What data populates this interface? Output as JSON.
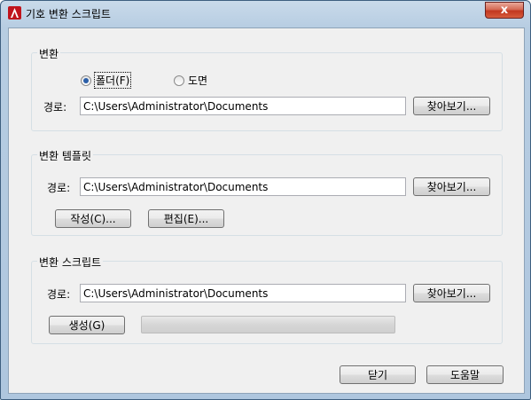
{
  "window": {
    "title": "기호 변환 스크립트",
    "close_label": "x"
  },
  "convert": {
    "label": "변환",
    "radio_folder": "폴더(F)",
    "radio_drawing": "도면",
    "path_label": "경로:",
    "path_value": "C:\\Users\\Administrator\\Documents",
    "browse_label": "찾아보기..."
  },
  "template": {
    "label": "변환 템플릿",
    "path_label": "경로:",
    "path_value": "C:\\Users\\Administrator\\Documents",
    "browse_label": "찾아보기...",
    "create_label": "작성(C)...",
    "edit_label": "편집(E)..."
  },
  "script": {
    "label": "변환 스크립트",
    "path_label": "경로:",
    "path_value": "C:\\Users\\Administrator\\Documents",
    "browse_label": "찾아보기...",
    "generate_label": "생성(G)",
    "progress": 0
  },
  "footer": {
    "close_label": "닫기",
    "help_label": "도움말"
  }
}
